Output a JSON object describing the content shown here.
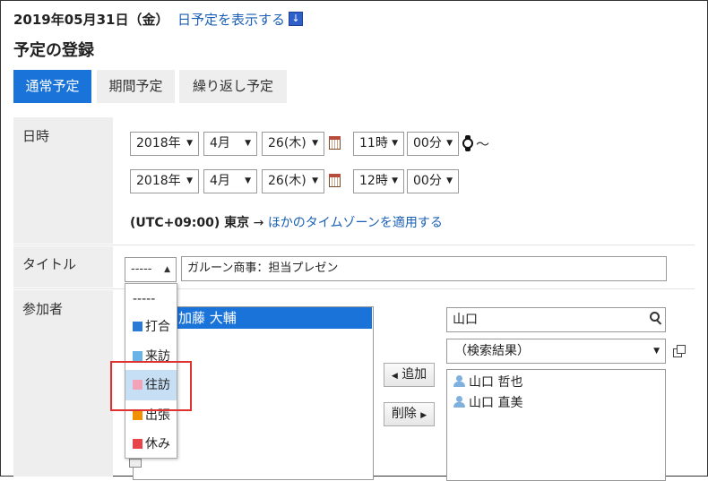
{
  "header": {
    "date": "2019年05月31日（金）",
    "show_day_link": "日予定を表示する",
    "show_day_icon": "↓",
    "page_title": "予定の登録"
  },
  "tabs": [
    {
      "label": "通常予定",
      "active": true
    },
    {
      "label": "期間予定",
      "active": false
    },
    {
      "label": "繰り返し予定",
      "active": false
    }
  ],
  "datetime": {
    "label": "日時",
    "start": {
      "year": "2018年",
      "month": "4月",
      "day": "26(木)",
      "hour": "11時",
      "minute": "00分"
    },
    "tilde": "～",
    "end": {
      "year": "2018年",
      "month": "4月",
      "day": "26(木)",
      "hour": "12時",
      "minute": "00分"
    },
    "timezone": "(UTC+09:00) 東京",
    "tz_arrow": "→",
    "tz_link": "ほかのタイムゾーンを適用する"
  },
  "title_row": {
    "label": "タイトル",
    "menu_value": "-----",
    "input_value": "ガルーン商事：担当プレゼン"
  },
  "participants": {
    "label": "参加者",
    "selected": [
      "加藤 大輔"
    ],
    "add_button": "追加",
    "remove_button": "削除",
    "search_value": "山口",
    "result_select": "（検索結果）",
    "results": [
      "山口 哲也",
      "山口 直美"
    ]
  },
  "title_menu_options": [
    {
      "label": "-----",
      "color": null,
      "highlighted": false
    },
    {
      "label": "打合",
      "color": "#2b7bd6",
      "highlighted": false
    },
    {
      "label": "来訪",
      "color": "#69b3e7",
      "highlighted": false
    },
    {
      "label": "往訪",
      "color": "#f2a3b8",
      "highlighted": true
    },
    {
      "label": "出張",
      "color": "#f29100",
      "highlighted": false
    },
    {
      "label": "休み",
      "color": "#e8454a",
      "highlighted": false
    }
  ],
  "colors": {
    "accent": "#1a73d9",
    "link": "#1a5fb4",
    "highlight_frame": "#e03131"
  }
}
